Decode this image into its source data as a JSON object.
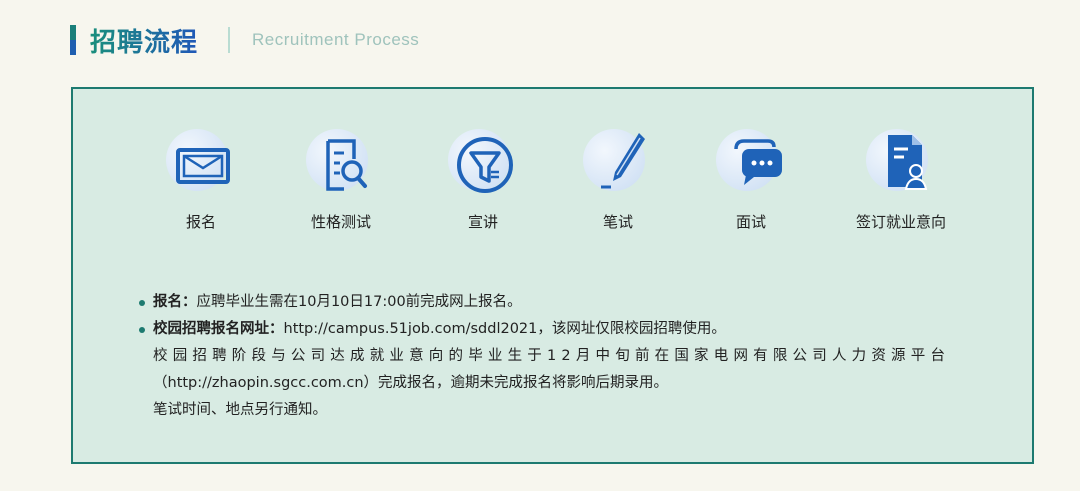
{
  "header": {
    "title": "招聘流程",
    "subtitle": "Recruitment Process"
  },
  "steps": [
    {
      "label": "报名",
      "icon": "envelope-icon"
    },
    {
      "label": "性格测试",
      "icon": "document-search-icon"
    },
    {
      "label": "宣讲",
      "icon": "filter-icon"
    },
    {
      "label": "笔试",
      "icon": "pen-icon"
    },
    {
      "label": "面试",
      "icon": "chat-bubble-icon"
    },
    {
      "label": "签订就业意向",
      "icon": "signed-contract-icon"
    }
  ],
  "info": {
    "line1_label": "报名：",
    "line1_text": "应聘毕业生需在10月10日17:00前完成网上报名。",
    "line2_label": "校园招聘报名网址：",
    "line2_text": "http://campus.51job.com/sddl2021，该网址仅限校园招聘使用。",
    "line3_text": "校园招聘阶段与公司达成就业意向的毕业生于12月中旬前在国家电网有限公司人力资源平台",
    "line4_text": "（http://zhaopin.sgcc.com.cn）完成报名，逾期未完成报名将影响后期录用。",
    "line5_text": "笔试时间、地点另行通知。"
  },
  "colors": {
    "accent_teal": "#1d7a70",
    "accent_blue": "#1f63b8",
    "panel_bg": "#d8ebe3"
  }
}
